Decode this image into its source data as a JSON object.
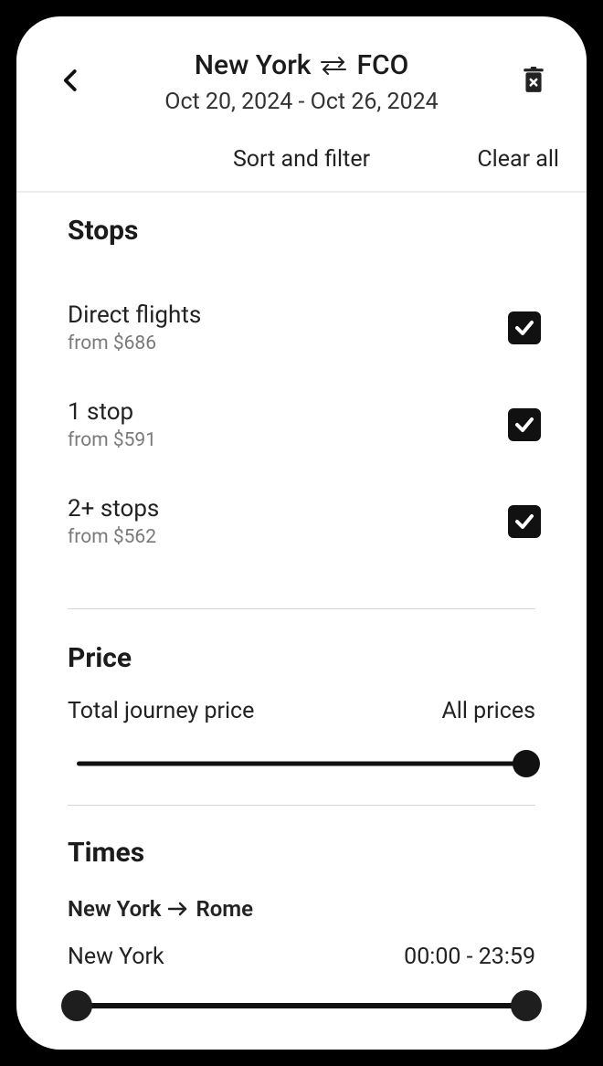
{
  "header": {
    "origin": "New York",
    "destination": "FCO",
    "dates": "Oct 20, 2024 - Oct 26, 2024"
  },
  "subheader": {
    "title": "Sort and filter",
    "clear": "Clear all"
  },
  "sections": {
    "stops_title": "Stops",
    "price_title": "Price",
    "times_title": "Times"
  },
  "stops": [
    {
      "label": "Direct flights",
      "from": "from $686",
      "checked": true
    },
    {
      "label": "1 stop",
      "from": "from $591",
      "checked": true
    },
    {
      "label": "2+ stops",
      "from": "from $562",
      "checked": true
    }
  ],
  "price": {
    "label": "Total journey price",
    "value_label": "All prices"
  },
  "times": {
    "route_from": "New York",
    "route_to": "Rome",
    "leg_label": "New York",
    "range": "00:00 - 23:59"
  }
}
